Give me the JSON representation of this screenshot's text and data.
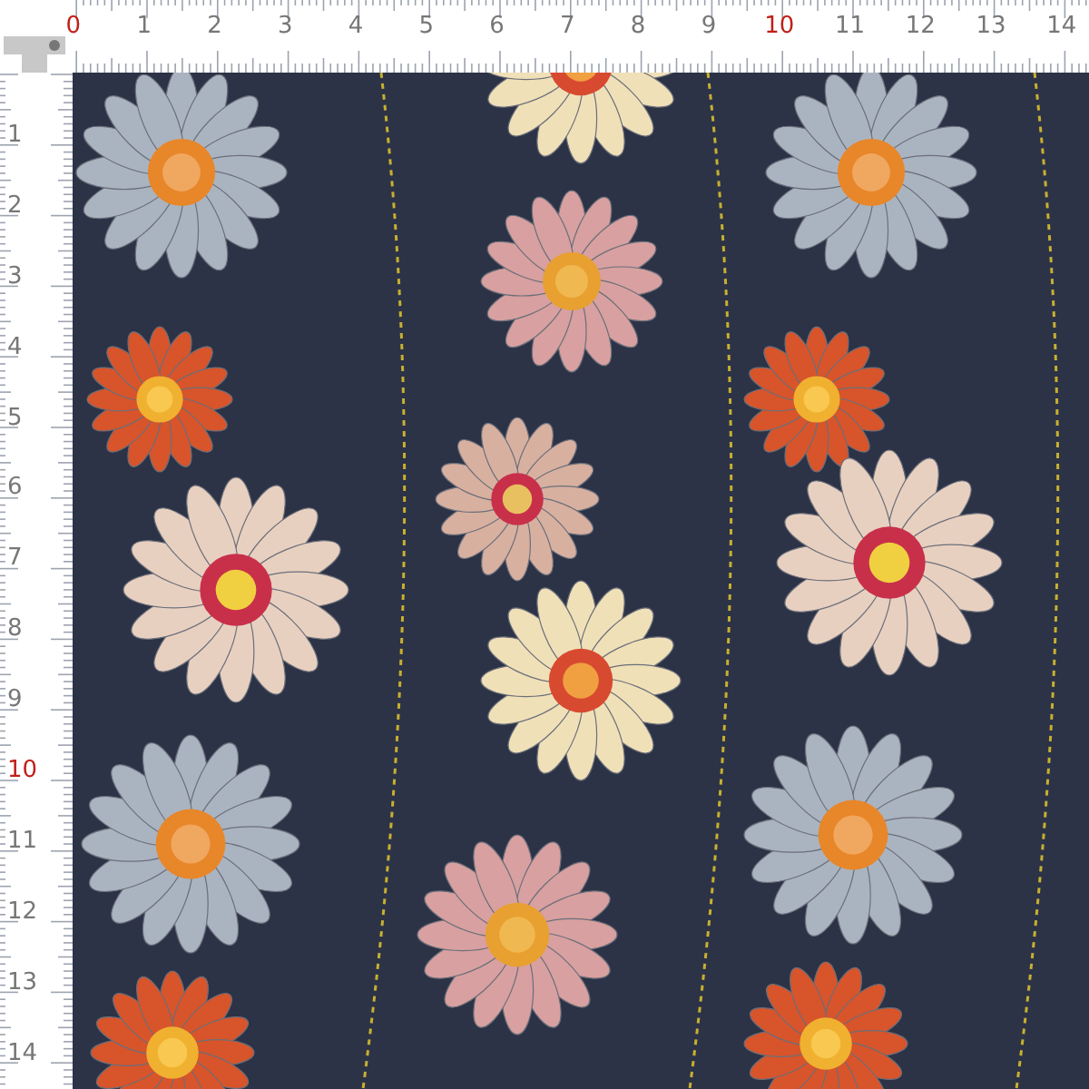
{
  "top_ruler": {
    "labels": [
      {
        "text": "0",
        "highlight": true
      },
      {
        "text": "1",
        "highlight": false
      },
      {
        "text": "2",
        "highlight": false
      },
      {
        "text": "3",
        "highlight": false
      },
      {
        "text": "4",
        "highlight": false
      },
      {
        "text": "5",
        "highlight": false
      },
      {
        "text": "6",
        "highlight": false
      },
      {
        "text": "7",
        "highlight": false
      },
      {
        "text": "8",
        "highlight": false
      },
      {
        "text": "9",
        "highlight": false
      },
      {
        "text": "10",
        "highlight": true
      },
      {
        "text": "11",
        "highlight": false
      },
      {
        "text": "12",
        "highlight": false
      },
      {
        "text": "13",
        "highlight": false
      },
      {
        "text": "14",
        "highlight": false
      }
    ]
  },
  "left_ruler": {
    "labels": [
      {
        "text": "1",
        "highlight": false
      },
      {
        "text": "2",
        "highlight": false
      },
      {
        "text": "3",
        "highlight": false
      },
      {
        "text": "4",
        "highlight": false
      },
      {
        "text": "5",
        "highlight": false
      },
      {
        "text": "6",
        "highlight": false
      },
      {
        "text": "7",
        "highlight": false
      },
      {
        "text": "8",
        "highlight": false
      },
      {
        "text": "9",
        "highlight": false
      },
      {
        "text": "10",
        "highlight": true
      },
      {
        "text": "11",
        "highlight": false
      },
      {
        "text": "12",
        "highlight": false
      },
      {
        "text": "13",
        "highlight": false
      },
      {
        "text": "14",
        "highlight": false
      }
    ]
  }
}
